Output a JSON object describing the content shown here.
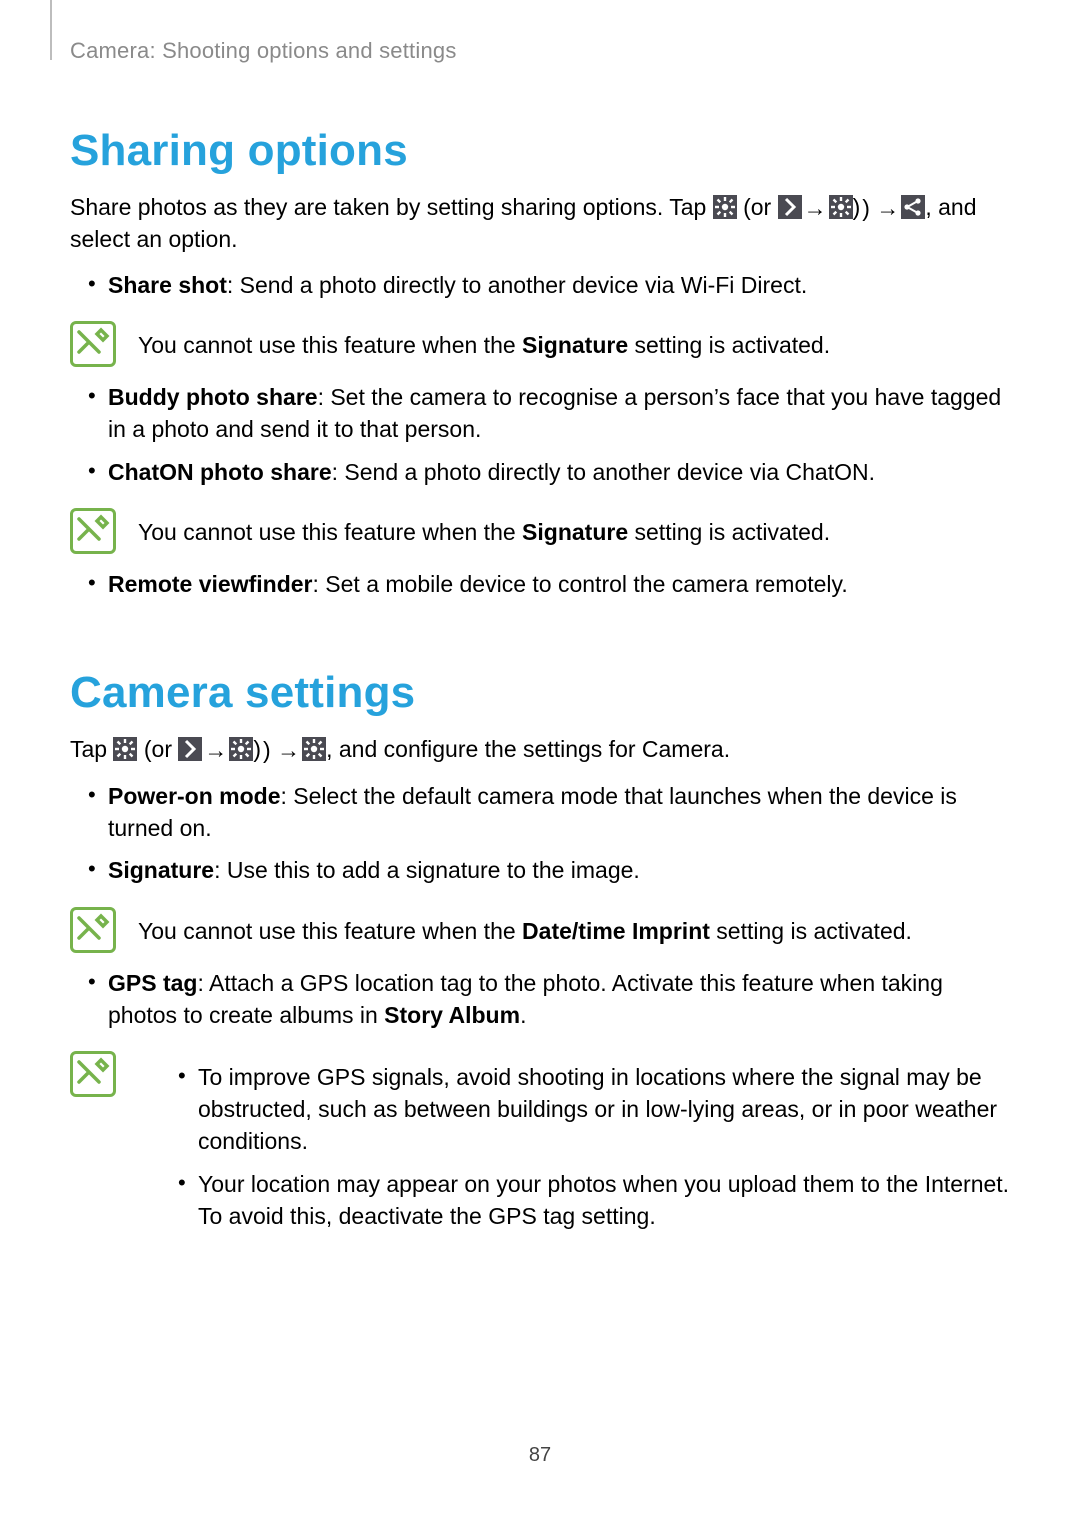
{
  "breadcrumb": "Camera: Shooting options and settings",
  "section1": {
    "title": "Sharing options",
    "intro_a": "Share photos as they are taken by setting sharing options. Tap ",
    "intro_b": " (or ",
    "intro_c": " → ",
    "intro_d": ") → ",
    "intro_e": ", and select an option.",
    "bullets1": [
      {
        "term": "Share shot",
        "desc": ": Send a photo directly to another device via Wi-Fi Direct."
      }
    ],
    "note1_a": "You cannot use this feature when the ",
    "note1_b": "Signature",
    "note1_c": " setting is activated.",
    "bullets2": [
      {
        "term": "Buddy photo share",
        "desc": ": Set the camera to recognise a person’s face that you have tagged in a photo and send it to that person."
      },
      {
        "term": "ChatON photo share",
        "desc": ": Send a photo directly to another device via ChatON."
      }
    ],
    "note2_a": "You cannot use this feature when the ",
    "note2_b": "Signature",
    "note2_c": " setting is activated.",
    "bullets3": [
      {
        "term": "Remote viewfinder",
        "desc": ": Set a mobile device to control the camera remotely."
      }
    ]
  },
  "section2": {
    "title": "Camera settings",
    "intro_a": "Tap ",
    "intro_b": " (or ",
    "intro_c": " → ",
    "intro_d": ") → ",
    "intro_e": ", and configure the settings for Camera.",
    "bullets1": [
      {
        "term": "Power-on mode",
        "desc": ": Select the default camera mode that launches when the device is turned on."
      },
      {
        "term": "Signature",
        "desc": ": Use this to add a signature to the image."
      }
    ],
    "note1_a": "You cannot use this feature when the ",
    "note1_b": "Date/time Imprint",
    "note1_c": " setting is activated.",
    "bullets2": [
      {
        "term": "GPS tag",
        "desc_a": ": Attach a GPS location tag to the photo. Activate this feature when taking photos to create albums in ",
        "desc_b": "Story Album",
        "desc_c": "."
      }
    ],
    "note2_items": [
      "To improve GPS signals, avoid shooting in locations where the signal may be obstructed, such as between buildings or in low-lying areas, or in poor weather conditions.",
      "Your location may appear on your photos when you upload them to the Internet. To avoid this, deactivate the GPS tag setting."
    ]
  },
  "page_number": "87"
}
